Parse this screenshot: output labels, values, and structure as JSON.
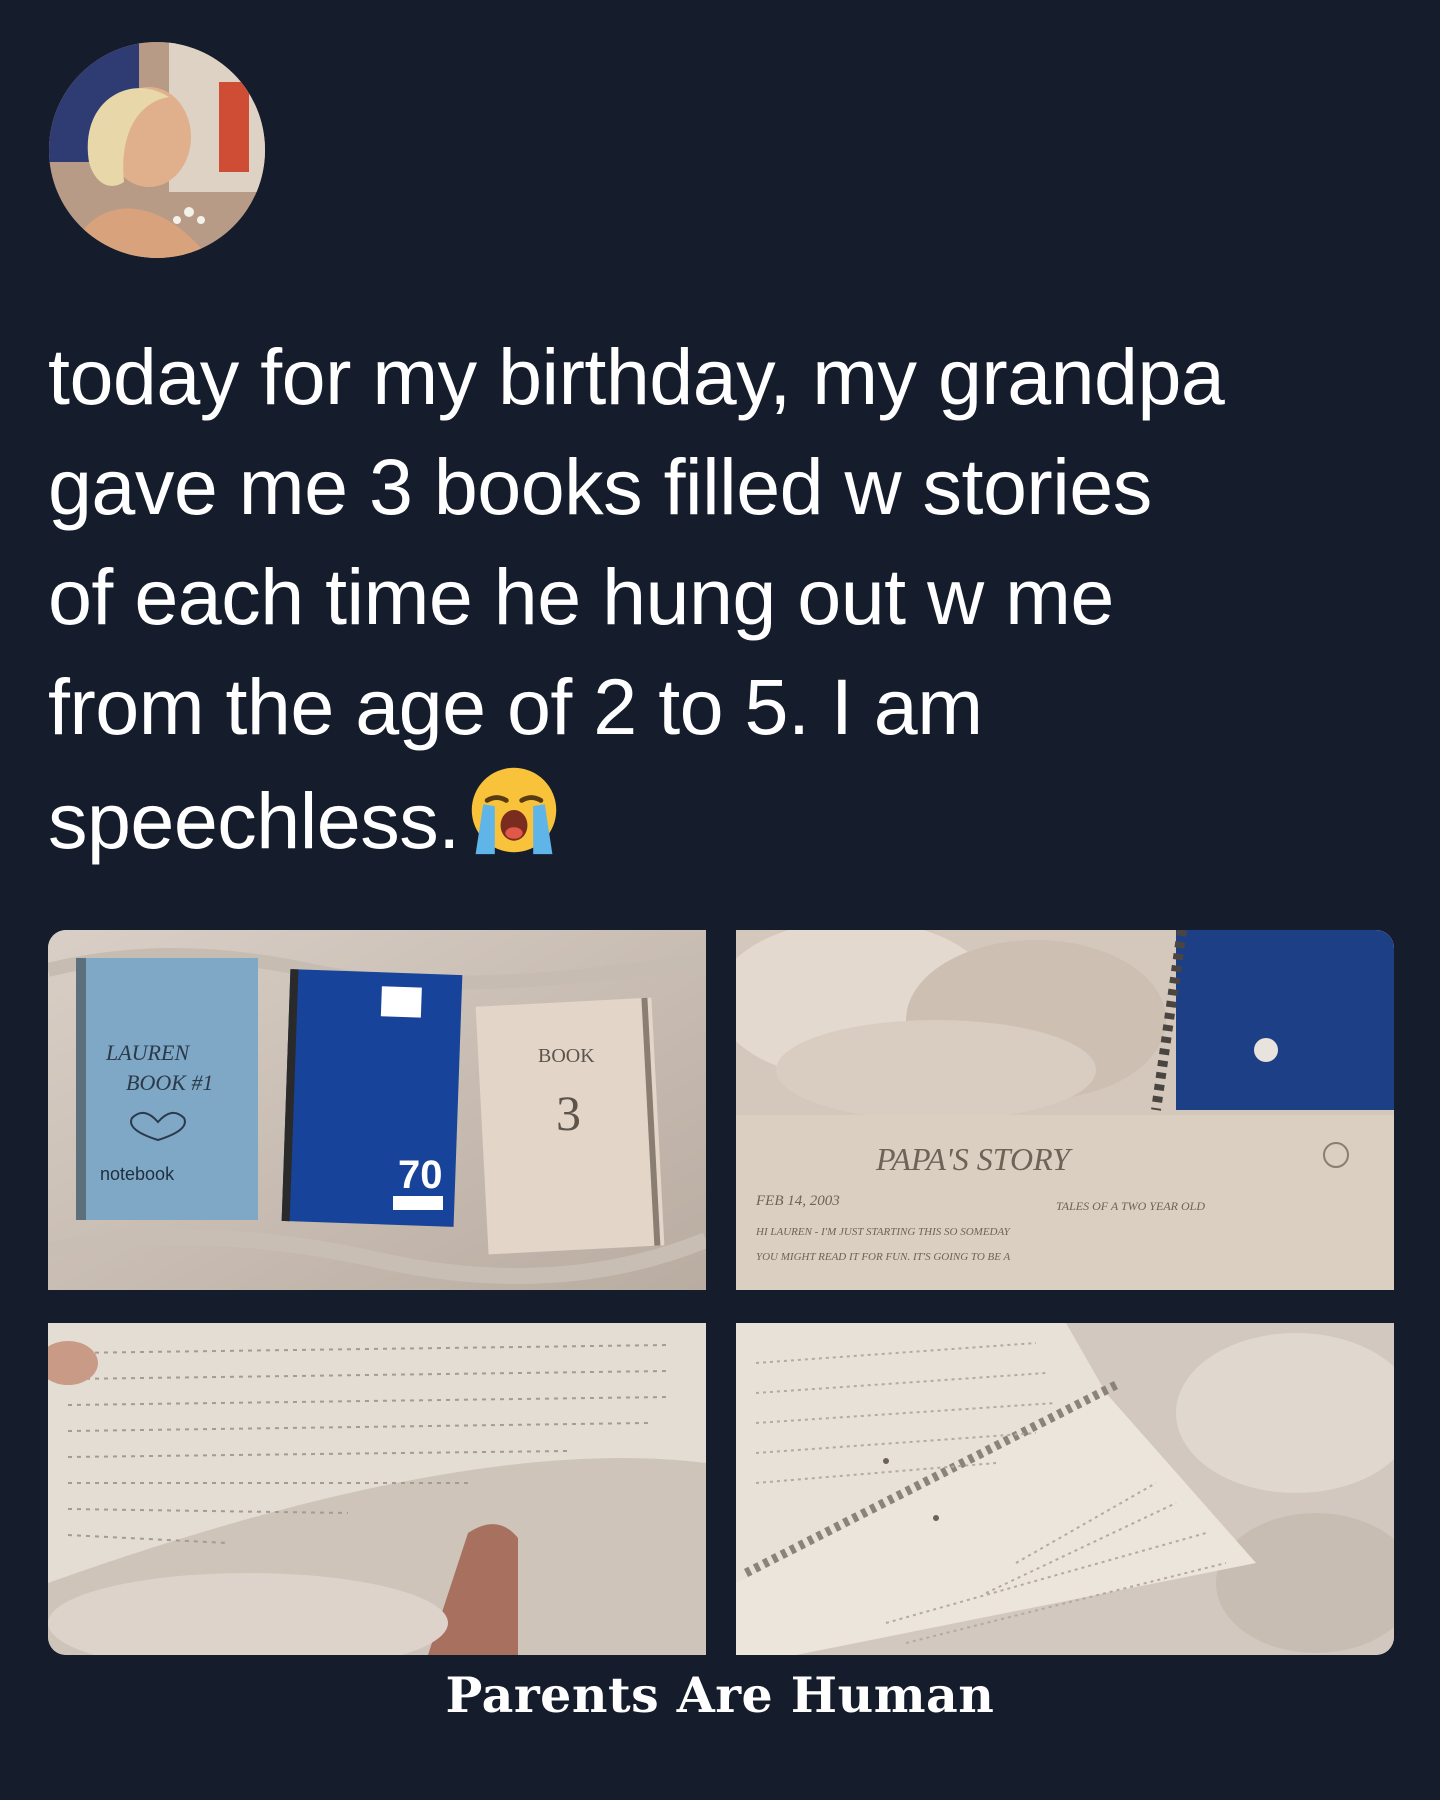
{
  "post": {
    "avatar": {
      "icon": "profile-photo"
    },
    "text_lines": [
      "today for my birthday, my grandpa",
      "gave me 3 books filled w stories",
      "of each time he hung out w me",
      "from the age of 2 to 5. I am",
      "speechless."
    ],
    "emoji": "loudly-crying-face"
  },
  "photos": {
    "photo1": {
      "notebook1_line1": "LAUREN",
      "notebook1_line2": "BOOK #1",
      "notebook1_brand": "notebook",
      "notebook2_count": "70",
      "notebook3_line1": "BOOK",
      "notebook3_line2": "3"
    },
    "photo2": {
      "page_title": "PAPA'S STORY",
      "page_date": "FEB 14, 2003",
      "page_subtitle": "TALES OF A TWO YEAR OLD",
      "page_line1": "HI LAUREN - I'M JUST STARTING THIS SO SOMEDAY",
      "page_line2": "YOU MIGHT READ IT FOR FUN. IT'S GOING TO BE A"
    }
  },
  "footer": {
    "watermark": "Parents Are Human"
  },
  "colors": {
    "background": "#151d2c",
    "text": "#ffffff"
  }
}
